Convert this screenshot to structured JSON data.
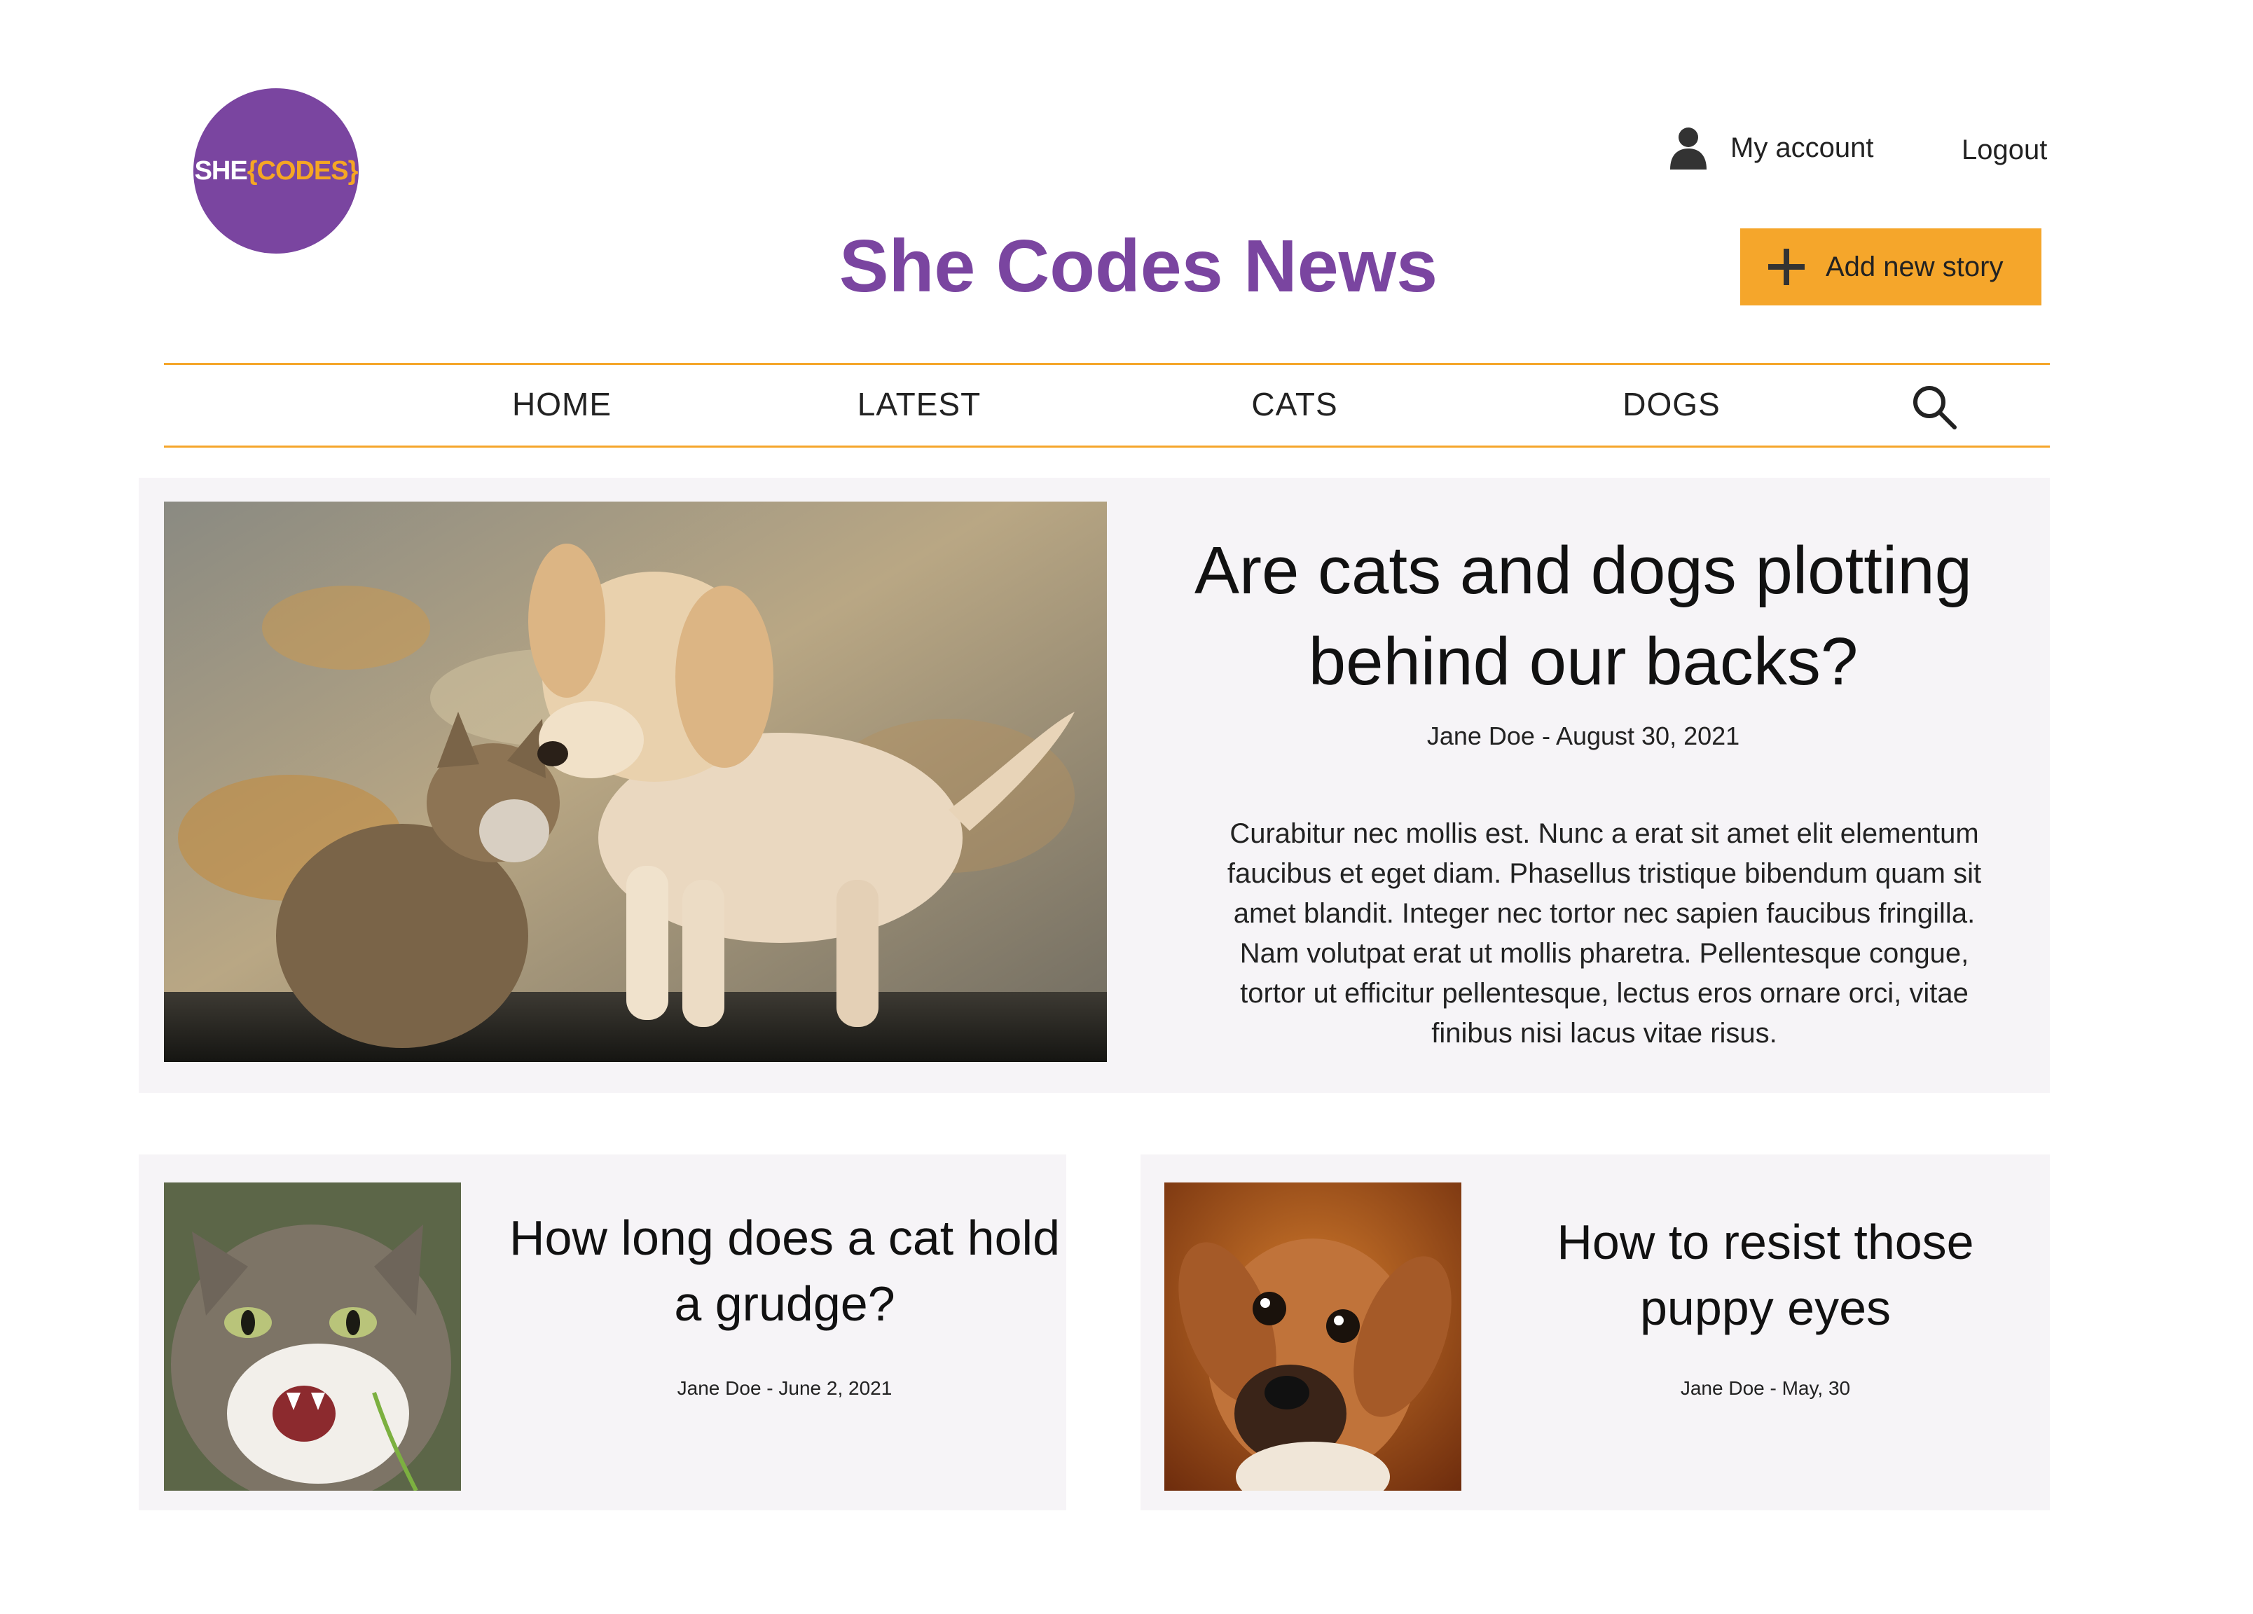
{
  "brand": {
    "logo_main": "SHE",
    "logo_accent": "{CODES}",
    "site_title": "She Codes News",
    "primary_color": "#7a45a0",
    "accent_color": "#f5a62b"
  },
  "header": {
    "account_icon": "user-icon",
    "my_account": "My account",
    "logout": "Logout",
    "add_icon": "plus-icon",
    "add_story": "Add new story"
  },
  "nav": {
    "items": [
      "HOME",
      "LATEST",
      "CATS",
      "DOGS"
    ],
    "search_icon": "search-icon"
  },
  "featured": {
    "image": "kitten-and-puppy-photo",
    "title": "Are cats and dogs plotting behind our backs?",
    "meta": "Jane Doe - August 30, 2021",
    "body": "Curabitur nec mollis est. Nunc a erat sit amet elit elementum faucibus et eget diam. Phasellus tristique bibendum quam sit amet blandit. Integer nec tortor nec sapien faucibus fringilla. Nam volutpat erat ut mollis pharetra. Pellentesque congue, tortor ut efficitur pellentesque, lectus eros ornare orci, vitae finibus nisi lacus vitae risus."
  },
  "stories": [
    {
      "image": "hissing-cat-photo",
      "title": "How long does a cat hold a grudge?",
      "meta": "Jane Doe - June 2, 2021"
    },
    {
      "image": "puppy-eyes-photo",
      "title": "How to resist those puppy eyes",
      "meta": "Jane Doe - May, 30"
    }
  ]
}
